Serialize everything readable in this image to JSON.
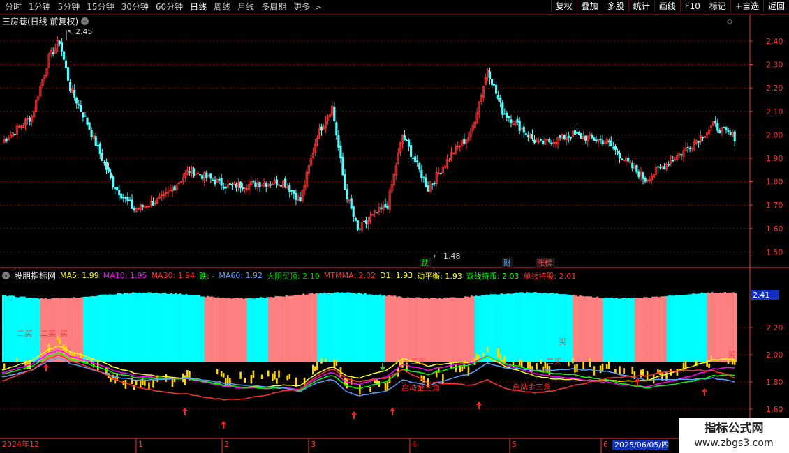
{
  "toolbar": {
    "periods": [
      "分时",
      "1分钟",
      "5分钟",
      "15分钟",
      "30分钟",
      "60分钟",
      "日线",
      "周线",
      "月线",
      "多周期",
      "更多"
    ],
    "active_period": "日线",
    "buttons": [
      "复权",
      "叠加",
      "多股",
      "统计",
      "画线",
      "F10",
      "标记",
      "+自选",
      "返回"
    ]
  },
  "main_chart": {
    "title": "三房巷(日线 前复权)",
    "y_ticks": [
      "2.40",
      "2.30",
      "2.20",
      "2.10",
      "2.00",
      "1.90",
      "1.80",
      "1.70",
      "1.60",
      "1.50"
    ],
    "high_label": "2.45",
    "low_label": "1.48",
    "event_labels": [
      {
        "text": "跌",
        "color": "#22cc22"
      },
      {
        "text": "财",
        "color": "#5aa0ff"
      },
      {
        "text": "涨榜",
        "color": "#ff4040"
      }
    ]
  },
  "indicator": {
    "name": "股朋指标网",
    "values": [
      {
        "text": "MA5: 1.99",
        "color": "#ffff00"
      },
      {
        "text": "MA10: 1.95",
        "color": "#ff00ff"
      },
      {
        "text": "MA30: 1.94",
        "color": "#ff3030"
      },
      {
        "text": "跌: -",
        "color": "#00ff00"
      },
      {
        "text": "MA60: 1.92",
        "color": "#5aa0ff"
      },
      {
        "text": "大阴买顶: 2.10",
        "color": "#00cc00"
      },
      {
        "text": "MTMMA: 2.02",
        "color": "#ff3030"
      },
      {
        "text": "D1: 1.93",
        "color": "#ffff00"
      },
      {
        "text": "动平衡: 1.93",
        "color": "#ffff00"
      },
      {
        "text": "双线持币: 2.03",
        "color": "#00ff00"
      },
      {
        "text": "单线持股: 2.01",
        "color": "#ff3030"
      }
    ],
    "y_ticks": [
      "2.20",
      "2.00",
      "1.80",
      "1.60"
    ],
    "current_value": "2.41",
    "annotations": [
      "二买",
      "二买",
      "买",
      "二买",
      "买",
      "买",
      "二买",
      "启动金三角",
      "启动金三角"
    ]
  },
  "x_axis": {
    "labels": [
      "2024年12",
      "1",
      "2",
      "3",
      "4",
      "5",
      "6"
    ],
    "cursor_date": "2025/06/05/四"
  },
  "watermark": {
    "line1": "指标公式网",
    "line2": "www.zbgs3.com"
  },
  "colors": {
    "up": "#ff3333",
    "down": "#54ffff",
    "grid": "#8b0000",
    "axis": "#ff3333",
    "pink": "#ff8080",
    "cyan": "#00ffff"
  }
}
